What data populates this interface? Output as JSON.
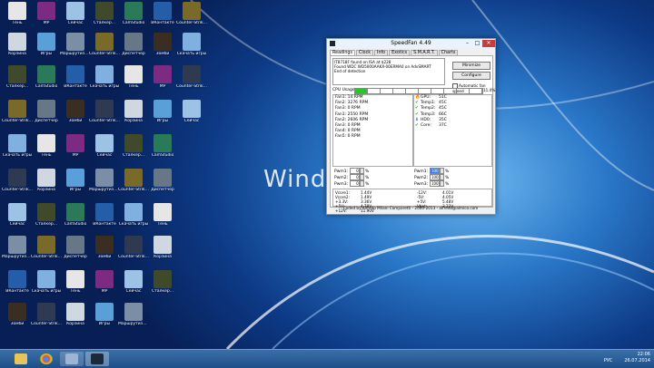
{
  "desktop": {
    "watermark": "Windo",
    "icons": [
      {
        "label": "Тень",
        "icon": "folder-icon",
        "color": "#e6e6e6"
      },
      {
        "label": "Корзина",
        "icon": "recycle-icon",
        "color": "#cfd8e0"
      },
      {
        "label": "Сталкер...",
        "icon": "game-icon",
        "color": "#3f4a2a"
      },
      {
        "label": "Counter-Strike 1.6",
        "icon": "game-icon",
        "color": "#7a6a2a"
      },
      {
        "label": "Скачать игры",
        "icon": "folder-icon",
        "color": "#7fb0e0"
      },
      {
        "label": "Counter-Strike GO",
        "icon": "game-icon",
        "color": "#2e3a52"
      },
      {
        "label": "Сейчас",
        "icon": "folder-icon",
        "color": "#9cc3e6"
      },
      {
        "label": "Маршрутизатор",
        "icon": "router-icon",
        "color": "#7a8ea6"
      },
      {
        "label": "ВКонтакте",
        "icon": "app-icon",
        "color": "#245ea8"
      },
      {
        "label": "Зомби",
        "icon": "game-icon",
        "color": "#3a2e22"
      },
      {
        "label": "MP",
        "icon": "app-icon",
        "color": "#7c2a82"
      },
      {
        "label": "Игры",
        "icon": "folder-icon",
        "color": "#5aa0d8"
      },
      {
        "label": "CamStudio",
        "icon": "app-icon",
        "color": "#2a7a5a"
      },
      {
        "label": "Диспетчер",
        "icon": "app-icon",
        "color": "#667788"
      }
    ]
  },
  "speedfan": {
    "title": "SpeedFan 4.49",
    "tabs": [
      "Readings",
      "Clock",
      "Info",
      "Exotics",
      "S.M.A.R.T.",
      "Charts"
    ],
    "log_lines": [
      "IT8718F found on ISA at $228",
      "Found WDC WD5000AAKX-00ERMA0 on AdvSMART",
      "End of detection"
    ],
    "minimize_label": "Minimize",
    "configure_label": "Configure",
    "auto_speed_label": "Automatic fan speed",
    "cpu_usage_label": "CPU Usage",
    "cpu_usage_value": "11.4%",
    "cpu_usage_fraction": 0.11,
    "fans": [
      "Fan1: 14 RPM",
      "Fan2: 3276 RPM",
      "Fan3: 0 RPM",
      "Fan1: 2550 RPM",
      "Fan2: 2606 RPM",
      "Fan3: 0 RPM",
      "Fan4: 0 RPM",
      "Fan5: 0 RPM"
    ],
    "temps": [
      {
        "name": "GPU:",
        "value": "51C",
        "status": "fire"
      },
      {
        "name": "Temp1:",
        "value": "45C",
        "status": "ok"
      },
      {
        "name": "Temp2:",
        "value": "45C",
        "status": "ok"
      },
      {
        "name": "Temp3:",
        "value": "66C",
        "status": "ok"
      },
      {
        "name": "HD0:",
        "value": "35C",
        "status": "down"
      },
      {
        "name": "Core:",
        "value": "37C",
        "status": "ok"
      }
    ],
    "pwm_left": [
      {
        "label": "Pwm1:",
        "value": "0"
      },
      {
        "label": "Pwm2:",
        "value": "0"
      },
      {
        "label": "Pwm3:",
        "value": "0"
      }
    ],
    "pwm_right": [
      {
        "label": "Pwm1:",
        "value": "100"
      },
      {
        "label": "Pwm2:",
        "value": "100"
      },
      {
        "label": "Pwm3:",
        "value": "100"
      }
    ],
    "pct": "%",
    "volts_col1": [
      {
        "name": "Vcore1:",
        "value": "1.44V"
      },
      {
        "name": "Vcore2:",
        "value": "1.49V"
      },
      {
        "name": "+3.3V:",
        "value": "3.36V"
      },
      {
        "name": "+5V:",
        "value": "4.78V"
      },
      {
        "name": "+12V:",
        "value": "11.90V"
      }
    ],
    "volts_col2": [
      {
        "name": "-12V:",
        "value": "4.01V"
      },
      {
        "name": "-5V:",
        "value": "4.05V"
      },
      {
        "name": "+5V:",
        "value": "5.48V"
      },
      {
        "name": "Vbat:",
        "value": "3.22V"
      }
    ],
    "status_text": "Coded by Alfredo Milani Comparetti - 2000-2013 - alfredo@almico.com"
  },
  "taskbar": {
    "time": "22:06",
    "date": "26.07.2014",
    "lang": "РУС"
  }
}
